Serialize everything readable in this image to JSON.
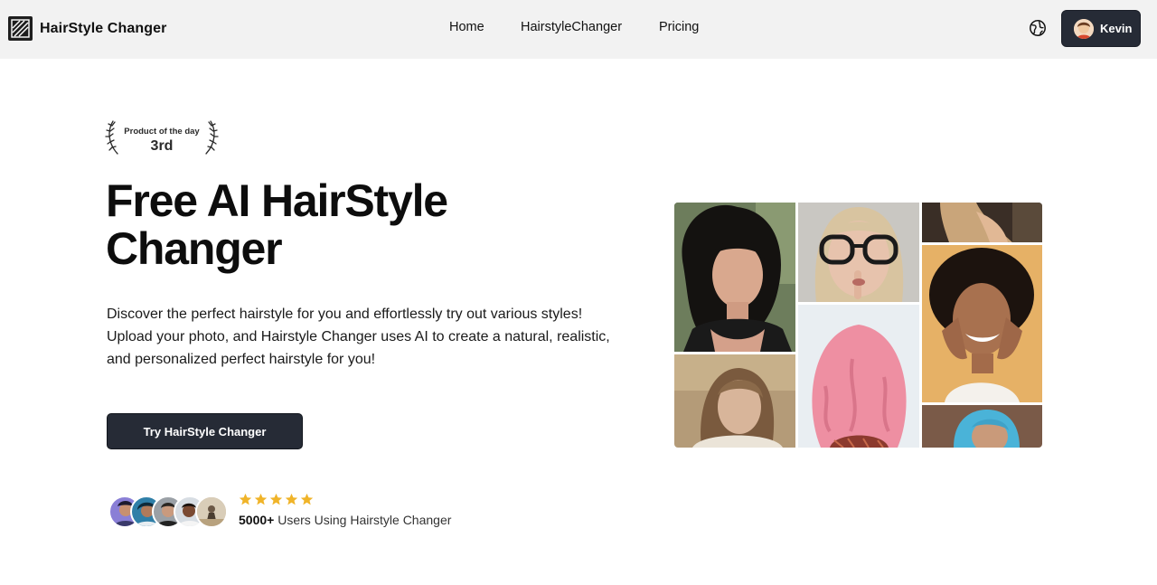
{
  "header": {
    "brand_name": "HairStyle Changer",
    "nav": [
      {
        "label": "Home"
      },
      {
        "label": "HairstyleChanger"
      },
      {
        "label": "Pricing"
      }
    ],
    "user_name": "Kevin"
  },
  "badge": {
    "label": "Product of the day",
    "rank": "3rd"
  },
  "hero": {
    "title": "Free AI HairStyle Changer",
    "description": "Discover the perfect hairstyle for you and effortlessly try out various styles! Upload your photo, and Hairstyle Changer uses AI to create a natural, realistic, and personalized perfect hairstyle for you!",
    "cta_label": "Try HairStyle Changer"
  },
  "social_proof": {
    "rating_stars": 5,
    "users_count": "5000+",
    "users_text": " Users Using Hairstyle Changer"
  },
  "colors": {
    "header_bg": "#f2f2f2",
    "button_bg": "#262b36",
    "star": "#f0b429"
  }
}
